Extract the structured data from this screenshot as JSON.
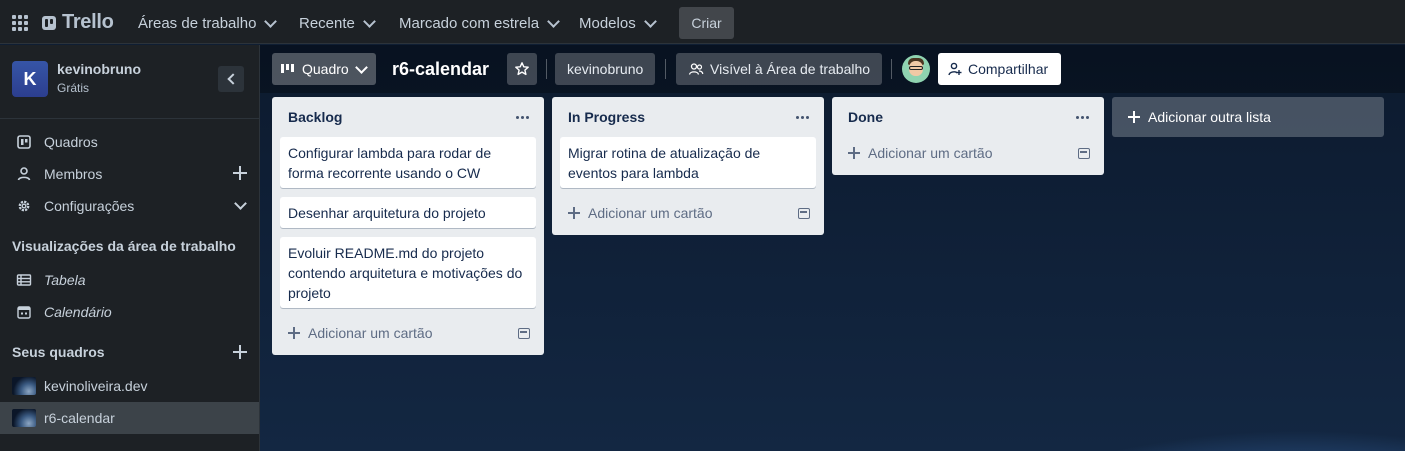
{
  "topbar": {
    "logo": "Trello",
    "nav": [
      {
        "label": "Áreas de trabalho"
      },
      {
        "label": "Recente"
      },
      {
        "label": "Marcado com estrela"
      },
      {
        "label": "Modelos"
      }
    ],
    "create_label": "Criar"
  },
  "sidebar": {
    "workspace": {
      "initial": "K",
      "name": "kevinobruno",
      "plan": "Grátis"
    },
    "items": [
      {
        "label": "Quadros",
        "icon": "board-icon"
      },
      {
        "label": "Membros",
        "icon": "person-icon"
      },
      {
        "label": "Configurações",
        "icon": "gear-icon"
      }
    ],
    "views_heading": "Visualizações da área de trabalho",
    "views": [
      {
        "label": "Tabela",
        "icon": "table-icon"
      },
      {
        "label": "Calendário",
        "icon": "calendar-icon"
      }
    ],
    "boards_heading": "Seus quadros",
    "boards": [
      {
        "label": "kevinoliveira.dev"
      },
      {
        "label": "r6-calendar",
        "active": true
      }
    ]
  },
  "board": {
    "view_label": "Quadro",
    "title": "r6-calendar",
    "workspace_label": "kevinobruno",
    "visibility_label": "Visível à Área de trabalho",
    "share_label": "Compartilhar",
    "lists": [
      {
        "title": "Backlog",
        "cards": [
          "Configurar lambda para rodar de forma recorrente usando o CW",
          "Desenhar arquitetura do projeto",
          "Evoluir README.md do projeto contendo arquitetura e motivações do projeto"
        ],
        "add_label": "Adicionar um cartão"
      },
      {
        "title": "In Progress",
        "cards": [
          "Migrar rotina de atualização de eventos para lambda"
        ],
        "add_label": "Adicionar um cartão"
      },
      {
        "title": "Done",
        "cards": [],
        "add_label": "Adicionar um cartão"
      }
    ],
    "add_list_label": "Adicionar outra lista"
  }
}
